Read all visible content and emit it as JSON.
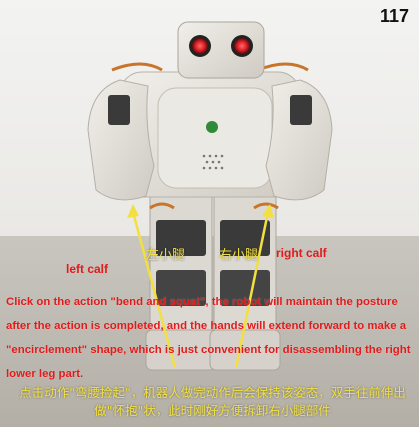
{
  "page_number": "117",
  "labels": {
    "cn_left_calf": "左小腿",
    "cn_right_calf": "右小腿",
    "left_calf": "left calf",
    "right_calf": "right calf"
  },
  "caption": {
    "english": "Click on the action \"bend and squat\", the robot will maintain the posture after the action is completed, and the hands will extend forward to make a \"encirclement\" shape, which is just convenient for disassembling the right lower leg part.",
    "chinese": "点击动作\"弯腰捡起\"，机器人做完动作后会保持该姿态，双手往前伸出做\"怀抱\"状，此时刚好方便拆卸右小腿部件"
  },
  "colors": {
    "annotation_red": "#e11b1b",
    "annotation_yellow": "#f2e040",
    "robot_body": "#e6e4df",
    "eye_red": "#e0222a",
    "servo_orange": "#c8742a"
  }
}
